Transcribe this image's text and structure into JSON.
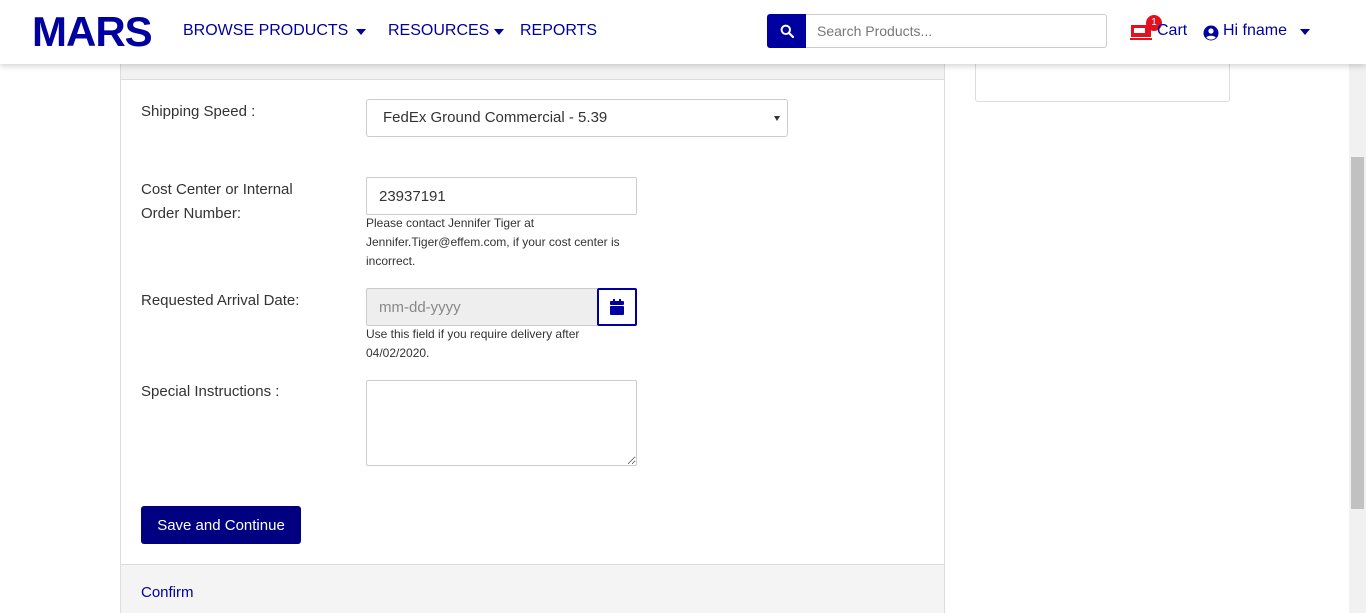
{
  "header": {
    "logo": "MARS",
    "nav": {
      "browse_products": "BROWSE PRODUCTS",
      "resources": "RESOURCES",
      "reports": "REPORTS"
    },
    "search": {
      "placeholder": "Search Products..."
    },
    "cart": {
      "label": "Cart",
      "count": "1"
    },
    "user": {
      "greeting": "Hi fname"
    }
  },
  "form": {
    "shipping_speed": {
      "label": "Shipping Speed :",
      "selected": "FedEx Ground Commercial - 5.39"
    },
    "cost_center": {
      "label_line1": "Cost Center or Internal",
      "label_line2": "Order Number:",
      "value": "23937191",
      "help_line1": "Please contact Jennifer Tiger at",
      "help_line2": "Jennifer.Tiger@effem.com, if your cost center is",
      "help_line3": "incorrect."
    },
    "arrival_date": {
      "label": "Requested Arrival Date:",
      "placeholder": "mm-dd-yyyy",
      "help_line1": "Use this field if you require delivery after",
      "help_line2": "04/02/2020."
    },
    "special_instructions": {
      "label": "Special Instructions :",
      "value": ""
    },
    "save_button": "Save and Continue"
  },
  "next_step": {
    "label": "Confirm"
  },
  "colors": {
    "brand": "#0000a0",
    "button": "#000080",
    "badge": "#e3101e"
  }
}
